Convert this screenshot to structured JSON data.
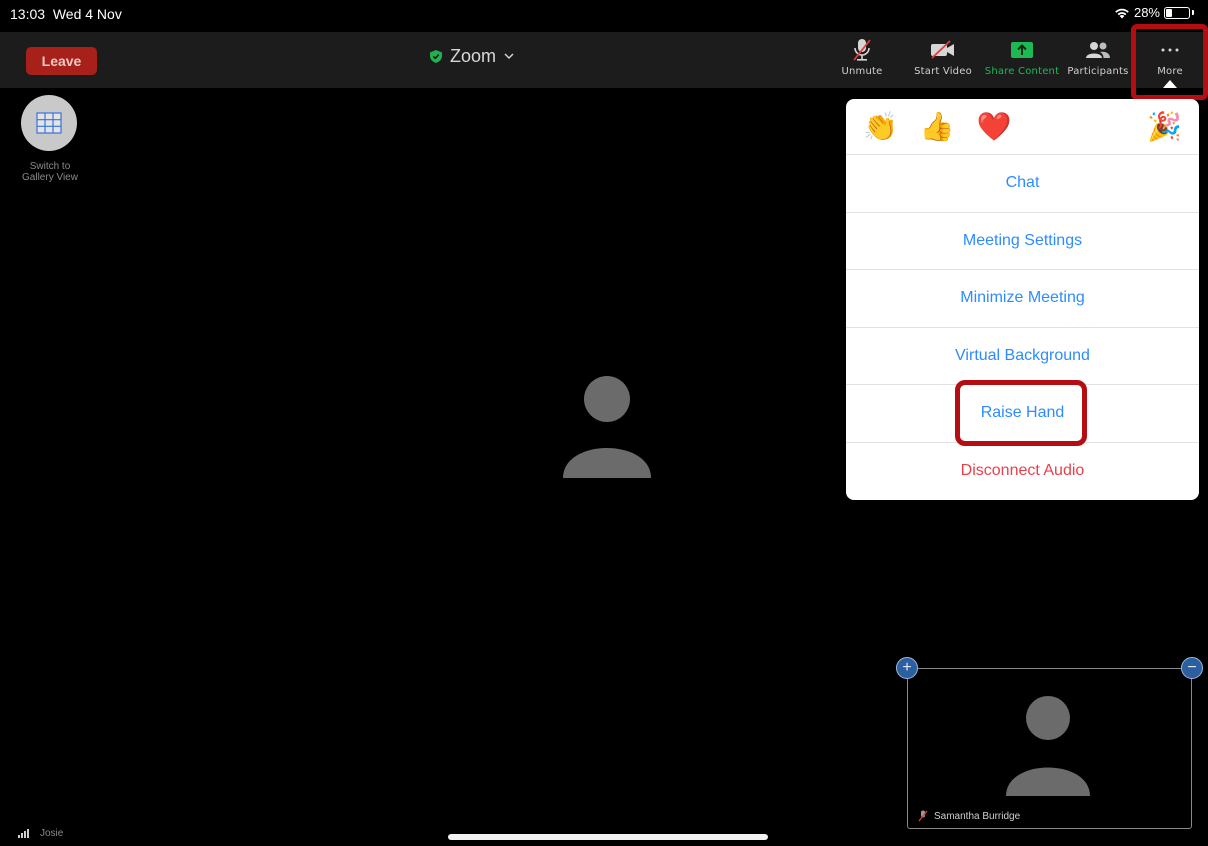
{
  "status": {
    "time": "13:03",
    "date": "Wed 4 Nov",
    "battery_percent": "28%",
    "battery_level": 0.28
  },
  "toolbar": {
    "leave_label": "Leave",
    "meeting_title": "Zoom",
    "unmute_label": "Unmute",
    "start_video_label": "Start Video",
    "share_label": "Share Content",
    "participants_label": "Participants",
    "more_label": "More"
  },
  "gallery": {
    "label_line1": "Switch to",
    "label_line2": "Gallery View"
  },
  "menu": {
    "reactions": [
      "👏",
      "👍",
      "❤️",
      "😂",
      "😮",
      "🎉"
    ],
    "items": [
      {
        "label": "Chat"
      },
      {
        "label": "Meeting Settings"
      },
      {
        "label": "Minimize Meeting"
      },
      {
        "label": "Virtual Background"
      },
      {
        "label": "Raise Hand"
      },
      {
        "label": "Disconnect Audio"
      }
    ]
  },
  "self_view": {
    "name": "Samantha Burridge"
  },
  "bottom": {
    "name": "Josie"
  },
  "colors": {
    "accent": "#2d8cff",
    "danger": "#e8414b",
    "leave": "#a8201a",
    "share": "#1db954",
    "highlight": "#b40d12"
  }
}
